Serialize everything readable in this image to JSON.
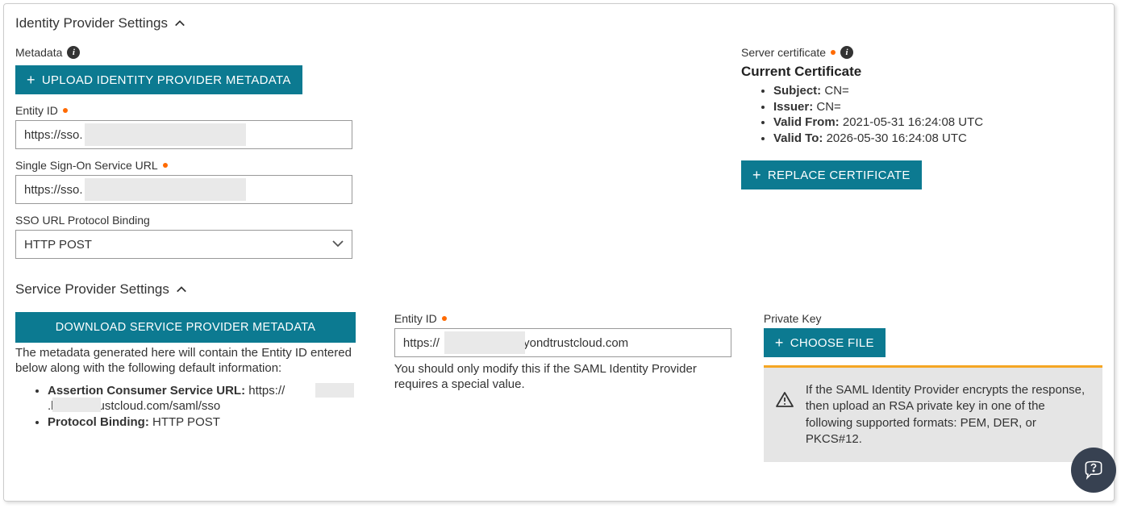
{
  "idp": {
    "section_title": "Identity Provider Settings",
    "metadata_label": "Metadata",
    "upload_btn": "UPLOAD IDENTITY PROVIDER METADATA",
    "entity_id_label": "Entity ID",
    "entity_id_value": "https://sso.                               /saml",
    "sso_url_label": "Single Sign-On Service URL",
    "sso_url_value": "https://sso.                               /saml/auth",
    "binding_label": "SSO URL Protocol Binding",
    "binding_value": "HTTP POST"
  },
  "cert": {
    "label": "Server certificate",
    "heading": "Current Certificate",
    "subject_label": "Subject:",
    "subject_value": "CN=",
    "issuer_label": "Issuer:",
    "issuer_value": "CN=",
    "valid_from_label": "Valid From:",
    "valid_from_value": "2021-05-31 16:24:08 UTC",
    "valid_to_label": "Valid To:",
    "valid_to_value": "2026-05-30 16:24:08 UTC",
    "replace_btn": "REPLACE CERTIFICATE"
  },
  "sp": {
    "section_title": "Service Provider Settings",
    "download_btn": "DOWNLOAD SERVICE PROVIDER METADATA",
    "desc": "The metadata generated here will contain the Entity ID entered below along with the following default information:",
    "acs_label": "Assertion Consumer Service URL:",
    "acs_value": "https://            .beyondtrustcloud.com/saml/sso",
    "pb_label": "Protocol Binding:",
    "pb_value": "HTTP POST",
    "entity_id_label": "Entity ID",
    "entity_id_value": "https://                    .beyondtrustcloud.com",
    "entity_id_help": "You should only modify this if the SAML Identity Provider requires a special value.",
    "pk_label": "Private Key",
    "choose_btn": "CHOOSE FILE",
    "alert": "If the SAML Identity Provider encrypts the response, then upload an RSA private key in one of the following supported formats: PEM, DER, or PKCS#12."
  }
}
